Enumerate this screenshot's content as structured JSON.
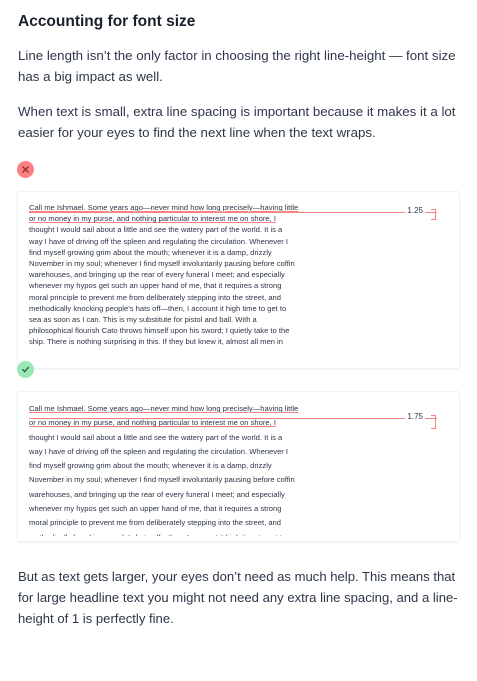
{
  "heading": "Accounting for font size",
  "intro": [
    "Line length isn’t the only factor in choosing the right line-height — font size has a big impact as well.",
    "When text is small, extra line spacing is important because it makes it a lot easier for your eyes to find the next line when the text wraps."
  ],
  "bad_example": {
    "line_height_label": "1.25",
    "lines": [
      "Call me Ishmael. Some years ago—never mind how long precisely—having little",
      "or no money in my purse, and nothing particular to interest me on shore, I",
      "thought I would sail about a little and see the watery part of the world. It is a",
      "way I have of driving off the spleen and regulating the circulation. Whenever I",
      "find myself growing grim about the mouth; whenever it is a damp, drizzly",
      "November in my soul; whenever I find myself involuntarily pausing before coffin",
      "warehouses, and bringing up the rear of every funeral I meet; and especially",
      "whenever my hypos get such an upper hand of me, that it requires a strong",
      "moral principle to prevent me from deliberately stepping into the street, and",
      "methodically knocking people’s hats off—then, I account it high time to get to",
      "sea as soon as I can. This is my substitute for pistol and ball. With a",
      "philosophical flourish Cato throws himself upon his sword; I quietly take to the",
      "ship. There is nothing surprising in this. If they but knew it, almost all men in"
    ]
  },
  "good_example": {
    "line_height_label": "1.75",
    "lines": [
      "Call me Ishmael. Some years ago—never mind how long precisely—having little",
      "or no money in my purse, and nothing particular to interest me on shore, I",
      "thought I would sail about a little and see the watery part of the world. It is a",
      "way I have of driving off the spleen and regulating the circulation. Whenever I",
      "find myself growing grim about the mouth; whenever it is a damp, drizzly",
      "November in my soul; whenever I find myself involuntarily pausing before coffin",
      "warehouses, and bringing up the rear of every funeral I meet; and especially",
      "whenever my hypos get such an upper hand of me, that it requires a strong",
      "moral principle to prevent me from deliberately stepping into the street, and",
      "methodically knocking people’s hats off—then, I account it high time to get to"
    ]
  },
  "outro": "But as text gets larger, your eyes don’t need as much help. This means that for large headline text you might not need any extra line spacing, and a line-height of 1 is perfectly fine.",
  "colors": {
    "bad": "#fc8181",
    "good": "#9ae6b4",
    "text": "#2d3748"
  },
  "icons": {
    "bad": "x-icon",
    "good": "check-icon"
  }
}
